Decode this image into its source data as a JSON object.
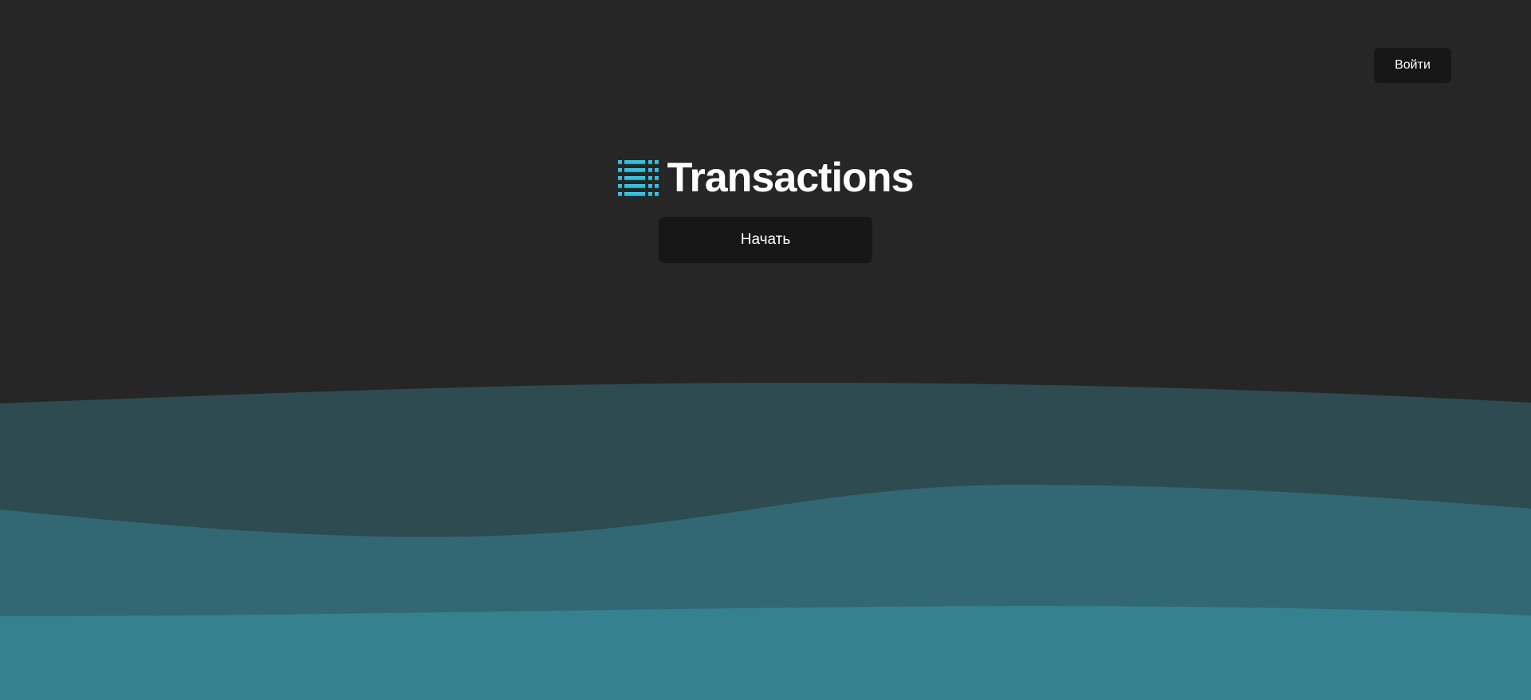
{
  "header": {
    "login_label": "Войти"
  },
  "hero": {
    "title": "Transactions",
    "start_label": "Начать",
    "icon": "list-lines-icon"
  },
  "colors": {
    "background": "#262626",
    "button_bg": "#171717",
    "accent": "#2fc3e0",
    "wave_top": "#2d4b51",
    "wave_middle": "#316873",
    "wave_bottom": "#36818f"
  }
}
